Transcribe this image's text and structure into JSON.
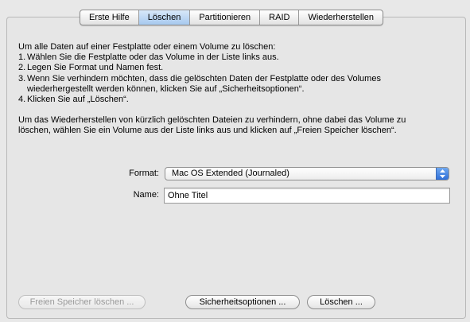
{
  "tabs": [
    {
      "label": "Erste Hilfe",
      "active": false
    },
    {
      "label": "Löschen",
      "active": true
    },
    {
      "label": "Partitionieren",
      "active": false
    },
    {
      "label": "RAID",
      "active": false
    },
    {
      "label": "Wiederherstellen",
      "active": false
    }
  ],
  "instructions": {
    "intro": "Um alle Daten auf einer Festplatte oder einem Volume zu löschen:",
    "steps": [
      {
        "num": "1.",
        "text": "Wählen Sie die Festplatte oder das Volume in der Liste links aus."
      },
      {
        "num": "2.",
        "text": "Legen Sie Format und Namen fest."
      },
      {
        "num": "3.",
        "text": "Wenn Sie verhindern möchten, dass die gelöschten Daten der Festplatte oder des Volumes",
        "text2": "wiederhergestellt werden können, klicken Sie auf „Sicherheitsoptionen“."
      },
      {
        "num": "4.",
        "text": "Klicken Sie auf „Löschen“."
      }
    ],
    "para2_line1": "Um das Wiederherstellen von kürzlich gelöschten Dateien zu verhindern, ohne dabei das Volume zu",
    "para2_line2": "löschen, wählen Sie ein Volume aus der Liste links aus und klicken auf „Freien Speicher löschen“."
  },
  "form": {
    "format_label": "Format:",
    "format_value": "Mac OS Extended (Journaled)",
    "name_label": "Name:",
    "name_value": "Ohne Titel"
  },
  "buttons": {
    "free_space": "Freien Speicher löschen ...",
    "security": "Sicherheitsoptionen ...",
    "erase": "Löschen ..."
  },
  "colors": {
    "active_tab": "#a6c9ef",
    "popup_arrow": "#2f6fd8"
  }
}
